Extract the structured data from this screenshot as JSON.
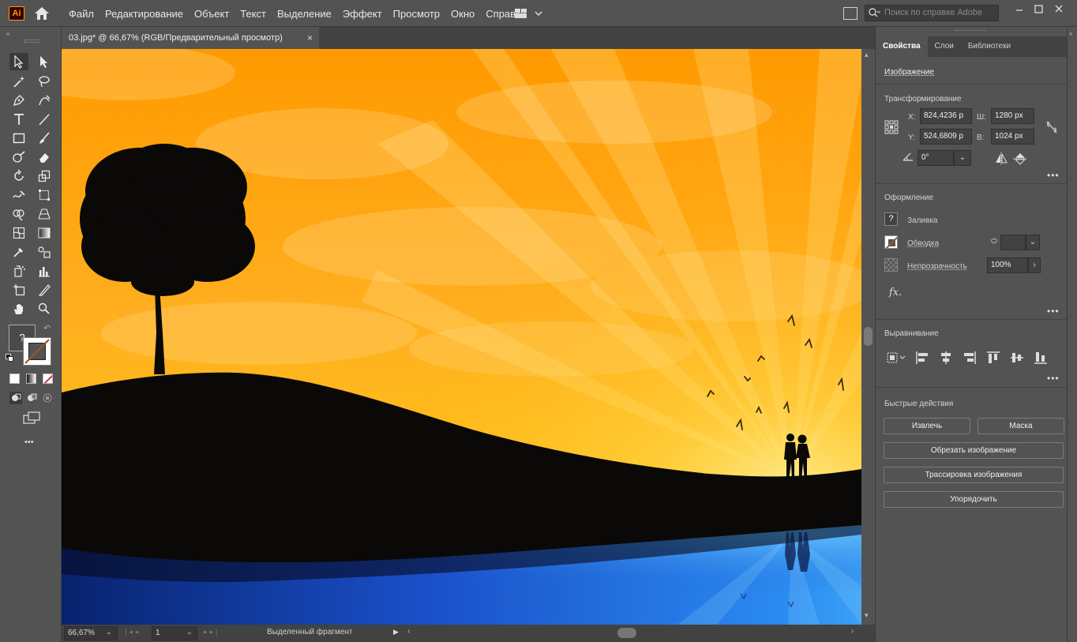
{
  "app": {
    "logo_text": "Ai"
  },
  "menu": [
    "Файл",
    "Редактирование",
    "Объект",
    "Текст",
    "Выделение",
    "Эффект",
    "Просмотр",
    "Окно",
    "Справка"
  ],
  "search": {
    "placeholder": "Поиск по справке Adobe"
  },
  "document": {
    "tab_title": "03.jpg* @ 66,67% (RGB/Предварительный просмотр)",
    "close": "×"
  },
  "toolbar": {
    "fill_unknown": "?",
    "more": "•••"
  },
  "status": {
    "zoom": "66,67%",
    "artboard": "1",
    "selection_label": "Выделенный фрагмент"
  },
  "panel": {
    "tabs": [
      "Свойства",
      "Слои",
      "Библиотеки"
    ],
    "object_type": "Изображение",
    "transform": {
      "title": "Трансформирование",
      "x_label": "X:",
      "x": "824,4236 р",
      "y_label": "Y:",
      "y": "524,6809 р",
      "w_label": "Ш:",
      "w": "1280 px",
      "h_label": "В:",
      "h": "1024 px",
      "angle": "0°"
    },
    "appearance": {
      "title": "Оформление",
      "fill_label": "Заливка",
      "stroke_label": "Обводка",
      "opacity_label": "Непрозрачность",
      "opacity": "100%",
      "fx": "fx."
    },
    "align": {
      "title": "Выравнивание"
    },
    "quick_actions": {
      "title": "Быстрые действия",
      "extract": "Извлечь",
      "mask": "Маска",
      "crop": "Обрезать изображение",
      "trace": "Трассировка изображения",
      "arrange": "Упорядочить"
    },
    "more": "•••"
  },
  "colors": {
    "sky_top": "#ff9d00",
    "sky_bottom": "#ffc21a",
    "water": "#1a5fd6",
    "silhouette": "#0b0a08",
    "accent": "#ff9a00"
  }
}
